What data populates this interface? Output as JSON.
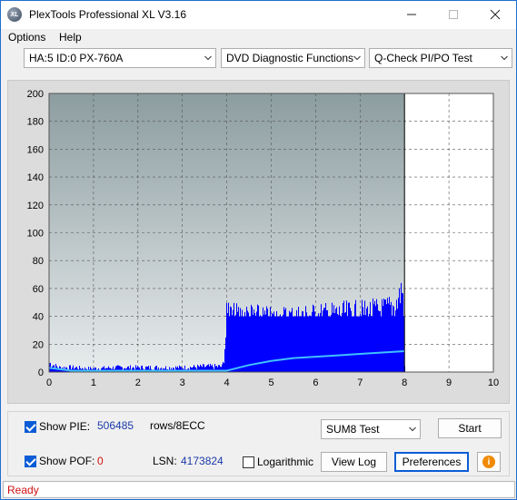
{
  "window": {
    "title": "PlexTools Professional XL V3.16",
    "app_icon_text": "XL",
    "icons": {
      "minimize": "minimize-icon",
      "maximize": "maximize-icon",
      "close": "close-icon"
    }
  },
  "menu": {
    "items": [
      {
        "label": "Options",
        "mnemonic": "O"
      },
      {
        "label": "Help",
        "mnemonic": "H"
      }
    ]
  },
  "toolbar": {
    "drive_select": "HA:5 ID:0  PX-760A",
    "function_select": "DVD Diagnostic Functions",
    "test_select": "Q-Check PI/PO Test"
  },
  "chart_data": {
    "type": "area",
    "title": "",
    "xlabel": "",
    "ylabel": "",
    "xlim": [
      0,
      10
    ],
    "ylim": [
      0,
      200
    ],
    "x_ticks": [
      "0",
      "1",
      "2",
      "3",
      "4",
      "5",
      "6",
      "7",
      "8",
      "9",
      "10"
    ],
    "y_ticks": [
      "0",
      "20",
      "40",
      "60",
      "80",
      "100",
      "120",
      "140",
      "160",
      "180",
      "200"
    ],
    "grid": true,
    "colors": {
      "bars": "#0000ff",
      "line": "#40c0ff",
      "plot_bg_top": "#8c9da0",
      "plot_bg_bottom": "#e8eced",
      "unwritten_bg": "#ffffff"
    },
    "end_marker_x": 8,
    "series": [
      {
        "kind": "bars",
        "x": [
          0,
          0.2,
          0.4,
          0.6,
          0.8,
          1.0,
          1.5,
          2.0,
          2.5,
          3.0,
          3.5,
          3.9,
          4.0,
          4.05,
          4.5,
          5.0,
          5.5,
          6.0,
          6.5,
          7.0,
          7.5,
          7.8,
          7.95,
          8.0
        ],
        "values": [
          10,
          5,
          5,
          5,
          4,
          4,
          5,
          5,
          5,
          5,
          6,
          6,
          56,
          50,
          50,
          47,
          49,
          50,
          51,
          52,
          54,
          58,
          74,
          0
        ]
      },
      {
        "kind": "line",
        "x": [
          0,
          0.5,
          1,
          2,
          3,
          3.9,
          4.0,
          4.5,
          5,
          5.5,
          6,
          6.5,
          7,
          7.5,
          8
        ],
        "values": [
          3,
          1,
          1,
          1,
          1,
          1,
          1,
          5,
          8,
          10,
          11,
          12,
          13,
          14,
          15
        ]
      }
    ]
  },
  "controls": {
    "show_pie_label": "Show PIE:",
    "pie_value": "506485",
    "pie_unit": "rows/8ECC",
    "show_pof_label": "Show POF:",
    "pof_value": "0",
    "lsn_label": "LSN:",
    "lsn_value": "4173824",
    "logarithmic_label": "Logarithmic",
    "show_pie_checked": true,
    "show_pof_checked": true,
    "logarithmic_checked": false,
    "test_mode_select": "SUM8 Test",
    "start_button": "Start",
    "view_log_button": "View Log",
    "preferences_button": "Preferences",
    "info_button": "i"
  },
  "status": {
    "text": "Ready"
  }
}
